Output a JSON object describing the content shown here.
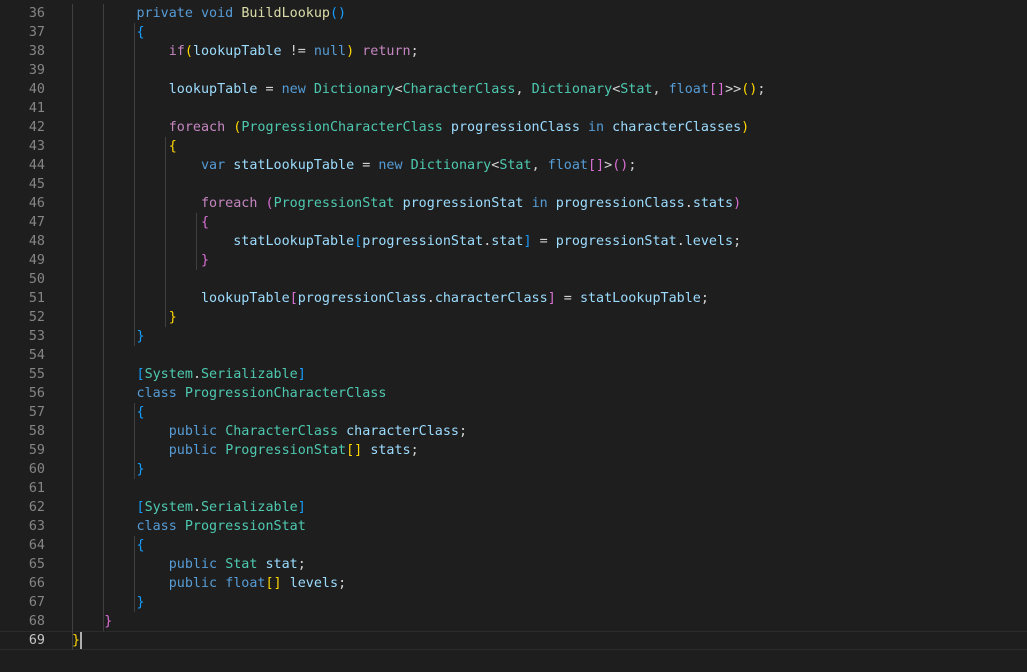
{
  "editor": {
    "first_line_number": 36,
    "current_line_number": 69,
    "colors": {
      "background": "#1e1e1e",
      "plain": "#d4d4d4",
      "keyword": "#569cd6",
      "control": "#c586c0",
      "type": "#4ec9b0",
      "variable": "#9cdcfe",
      "method": "#dcdcaa",
      "bracket1": "#ffd700",
      "bracket2": "#da70d6",
      "bracket3": "#179fff",
      "line_number": "#858585",
      "line_number_active": "#c6c6c6"
    },
    "lines": [
      {
        "n": "36",
        "t": [
          [
            "        ",
            "p"
          ],
          [
            "private",
            "k"
          ],
          [
            " ",
            "p"
          ],
          [
            "void",
            "k"
          ],
          [
            " ",
            "p"
          ],
          [
            "BuildLookup",
            "m"
          ],
          [
            "()",
            "b3"
          ]
        ]
      },
      {
        "n": "37",
        "t": [
          [
            "        ",
            "p"
          ],
          [
            "{",
            "b3"
          ]
        ]
      },
      {
        "n": "38",
        "t": [
          [
            "            ",
            "p"
          ],
          [
            "if",
            "c"
          ],
          [
            "(",
            "b1"
          ],
          [
            "lookupTable",
            "v"
          ],
          [
            " != ",
            "p"
          ],
          [
            "null",
            "k"
          ],
          [
            ")",
            "b1"
          ],
          [
            " ",
            "p"
          ],
          [
            "return",
            "c"
          ],
          [
            ";",
            "p"
          ]
        ]
      },
      {
        "n": "39",
        "t": []
      },
      {
        "n": "40",
        "t": [
          [
            "            ",
            "p"
          ],
          [
            "lookupTable",
            "v"
          ],
          [
            " = ",
            "p"
          ],
          [
            "new",
            "k"
          ],
          [
            " ",
            "p"
          ],
          [
            "Dictionary",
            "t"
          ],
          [
            "<",
            "p"
          ],
          [
            "CharacterClass",
            "t"
          ],
          [
            ", ",
            "p"
          ],
          [
            "Dictionary",
            "t"
          ],
          [
            "<",
            "p"
          ],
          [
            "Stat",
            "t"
          ],
          [
            ", ",
            "p"
          ],
          [
            "float",
            "k"
          ],
          [
            "[]",
            "b2"
          ],
          [
            ">>",
            "p"
          ],
          [
            "()",
            "b1"
          ],
          [
            ";",
            "p"
          ]
        ]
      },
      {
        "n": "41",
        "t": []
      },
      {
        "n": "42",
        "t": [
          [
            "            ",
            "p"
          ],
          [
            "foreach",
            "c"
          ],
          [
            " ",
            "p"
          ],
          [
            "(",
            "b1"
          ],
          [
            "ProgressionCharacterClass",
            "t"
          ],
          [
            " ",
            "p"
          ],
          [
            "progressionClass",
            "v"
          ],
          [
            " ",
            "p"
          ],
          [
            "in",
            "k"
          ],
          [
            " ",
            "p"
          ],
          [
            "characterClasses",
            "v"
          ],
          [
            ")",
            "b1"
          ]
        ]
      },
      {
        "n": "43",
        "t": [
          [
            "            ",
            "p"
          ],
          [
            "{",
            "b1"
          ]
        ]
      },
      {
        "n": "44",
        "t": [
          [
            "                ",
            "p"
          ],
          [
            "var",
            "k"
          ],
          [
            " ",
            "p"
          ],
          [
            "statLookupTable",
            "v"
          ],
          [
            " = ",
            "p"
          ],
          [
            "new",
            "k"
          ],
          [
            " ",
            "p"
          ],
          [
            "Dictionary",
            "t"
          ],
          [
            "<",
            "p"
          ],
          [
            "Stat",
            "t"
          ],
          [
            ", ",
            "p"
          ],
          [
            "float",
            "k"
          ],
          [
            "[]",
            "b2"
          ],
          [
            ">",
            "p"
          ],
          [
            "()",
            "b2"
          ],
          [
            ";",
            "p"
          ]
        ]
      },
      {
        "n": "45",
        "t": []
      },
      {
        "n": "46",
        "t": [
          [
            "                ",
            "p"
          ],
          [
            "foreach",
            "c"
          ],
          [
            " ",
            "p"
          ],
          [
            "(",
            "b2"
          ],
          [
            "ProgressionStat",
            "t"
          ],
          [
            " ",
            "p"
          ],
          [
            "progressionStat",
            "v"
          ],
          [
            " ",
            "p"
          ],
          [
            "in",
            "k"
          ],
          [
            " ",
            "p"
          ],
          [
            "progressionClass",
            "v"
          ],
          [
            ".",
            "p"
          ],
          [
            "stats",
            "v"
          ],
          [
            ")",
            "b2"
          ]
        ]
      },
      {
        "n": "47",
        "t": [
          [
            "                ",
            "p"
          ],
          [
            "{",
            "b2"
          ]
        ]
      },
      {
        "n": "48",
        "t": [
          [
            "                    ",
            "p"
          ],
          [
            "statLookupTable",
            "v"
          ],
          [
            "[",
            "b3"
          ],
          [
            "progressionStat",
            "v"
          ],
          [
            ".",
            "p"
          ],
          [
            "stat",
            "v"
          ],
          [
            "]",
            "b3"
          ],
          [
            " = ",
            "p"
          ],
          [
            "progressionStat",
            "v"
          ],
          [
            ".",
            "p"
          ],
          [
            "levels",
            "v"
          ],
          [
            ";",
            "p"
          ]
        ]
      },
      {
        "n": "49",
        "t": [
          [
            "                ",
            "p"
          ],
          [
            "}",
            "b2"
          ]
        ]
      },
      {
        "n": "50",
        "t": []
      },
      {
        "n": "51",
        "t": [
          [
            "                ",
            "p"
          ],
          [
            "lookupTable",
            "v"
          ],
          [
            "[",
            "b2"
          ],
          [
            "progressionClass",
            "v"
          ],
          [
            ".",
            "p"
          ],
          [
            "characterClass",
            "v"
          ],
          [
            "]",
            "b2"
          ],
          [
            " = ",
            "p"
          ],
          [
            "statLookupTable",
            "v"
          ],
          [
            ";",
            "p"
          ]
        ]
      },
      {
        "n": "52",
        "t": [
          [
            "            ",
            "p"
          ],
          [
            "}",
            "b1"
          ]
        ]
      },
      {
        "n": "53",
        "t": [
          [
            "        ",
            "p"
          ],
          [
            "}",
            "b3"
          ]
        ]
      },
      {
        "n": "54",
        "t": []
      },
      {
        "n": "55",
        "t": [
          [
            "        ",
            "p"
          ],
          [
            "[",
            "b3"
          ],
          [
            "System",
            "t"
          ],
          [
            ".",
            "p"
          ],
          [
            "Serializable",
            "t"
          ],
          [
            "]",
            "b3"
          ]
        ]
      },
      {
        "n": "56",
        "t": [
          [
            "        ",
            "p"
          ],
          [
            "class",
            "k"
          ],
          [
            " ",
            "p"
          ],
          [
            "ProgressionCharacterClass",
            "t"
          ]
        ]
      },
      {
        "n": "57",
        "t": [
          [
            "        ",
            "p"
          ],
          [
            "{",
            "b3"
          ]
        ]
      },
      {
        "n": "58",
        "t": [
          [
            "            ",
            "p"
          ],
          [
            "public",
            "k"
          ],
          [
            " ",
            "p"
          ],
          [
            "CharacterClass",
            "t"
          ],
          [
            " ",
            "p"
          ],
          [
            "characterClass",
            "v"
          ],
          [
            ";",
            "p"
          ]
        ]
      },
      {
        "n": "59",
        "t": [
          [
            "            ",
            "p"
          ],
          [
            "public",
            "k"
          ],
          [
            " ",
            "p"
          ],
          [
            "ProgressionStat",
            "t"
          ],
          [
            "[]",
            "b1"
          ],
          [
            " ",
            "p"
          ],
          [
            "stats",
            "v"
          ],
          [
            ";",
            "p"
          ]
        ]
      },
      {
        "n": "60",
        "t": [
          [
            "        ",
            "p"
          ],
          [
            "}",
            "b3"
          ]
        ]
      },
      {
        "n": "61",
        "t": []
      },
      {
        "n": "62",
        "t": [
          [
            "        ",
            "p"
          ],
          [
            "[",
            "b3"
          ],
          [
            "System",
            "t"
          ],
          [
            ".",
            "p"
          ],
          [
            "Serializable",
            "t"
          ],
          [
            "]",
            "b3"
          ]
        ]
      },
      {
        "n": "63",
        "t": [
          [
            "        ",
            "p"
          ],
          [
            "class",
            "k"
          ],
          [
            " ",
            "p"
          ],
          [
            "ProgressionStat",
            "t"
          ]
        ]
      },
      {
        "n": "64",
        "t": [
          [
            "        ",
            "p"
          ],
          [
            "{",
            "b3"
          ]
        ]
      },
      {
        "n": "65",
        "t": [
          [
            "            ",
            "p"
          ],
          [
            "public",
            "k"
          ],
          [
            " ",
            "p"
          ],
          [
            "Stat",
            "t"
          ],
          [
            " ",
            "p"
          ],
          [
            "stat",
            "v"
          ],
          [
            ";",
            "p"
          ]
        ]
      },
      {
        "n": "66",
        "t": [
          [
            "            ",
            "p"
          ],
          [
            "public",
            "k"
          ],
          [
            " ",
            "p"
          ],
          [
            "float",
            "k"
          ],
          [
            "[]",
            "b1"
          ],
          [
            " ",
            "p"
          ],
          [
            "levels",
            "v"
          ],
          [
            ";",
            "p"
          ]
        ]
      },
      {
        "n": "67",
        "t": [
          [
            "        ",
            "p"
          ],
          [
            "}",
            "b3"
          ]
        ]
      },
      {
        "n": "68",
        "t": [
          [
            "    ",
            "p"
          ],
          [
            "}",
            "b2"
          ]
        ]
      },
      {
        "n": "69",
        "t": [
          [
            "}",
            "b1"
          ]
        ]
      }
    ]
  }
}
